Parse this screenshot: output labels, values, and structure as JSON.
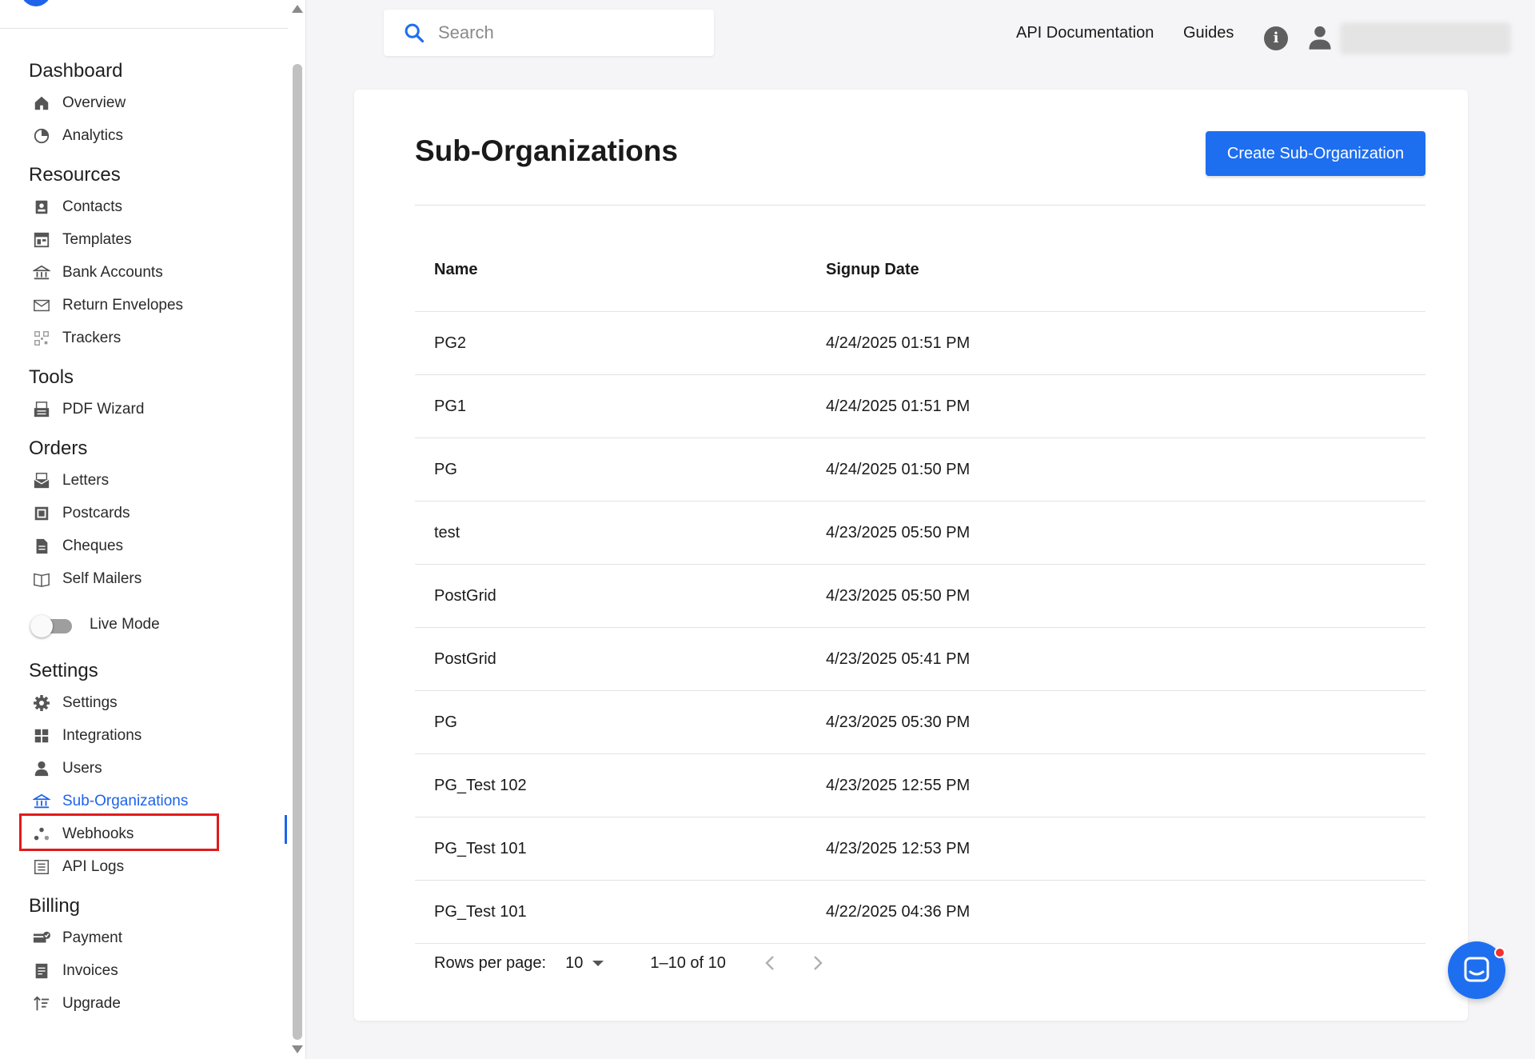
{
  "search": {
    "placeholder": "Search"
  },
  "topnav": {
    "api_docs": "API Documentation",
    "guides": "Guides"
  },
  "sidebar": {
    "sections": [
      {
        "title": "Dashboard",
        "items": [
          {
            "label": "Overview",
            "icon": "home-icon"
          },
          {
            "label": "Analytics",
            "icon": "pie-chart-icon"
          }
        ]
      },
      {
        "title": "Resources",
        "items": [
          {
            "label": "Contacts",
            "icon": "contacts-icon"
          },
          {
            "label": "Templates",
            "icon": "templates-icon"
          },
          {
            "label": "Bank Accounts",
            "icon": "bank-icon"
          },
          {
            "label": "Return Envelopes",
            "icon": "envelope-icon"
          },
          {
            "label": "Trackers",
            "icon": "qr-tracker-icon"
          }
        ]
      },
      {
        "title": "Tools",
        "items": [
          {
            "label": "PDF Wizard",
            "icon": "pdf-wizard-icon"
          }
        ]
      },
      {
        "title": "Orders",
        "items": [
          {
            "label": "Letters",
            "icon": "letter-icon"
          },
          {
            "label": "Postcards",
            "icon": "postcard-icon"
          },
          {
            "label": "Cheques",
            "icon": "cheque-icon"
          },
          {
            "label": "Self Mailers",
            "icon": "self-mailer-icon"
          }
        ]
      }
    ],
    "live_mode_label": "Live Mode",
    "live_mode_on": false,
    "sections2": [
      {
        "title": "Settings",
        "items": [
          {
            "label": "Settings",
            "icon": "gear-icon"
          },
          {
            "label": "Integrations",
            "icon": "integrations-icon"
          },
          {
            "label": "Users",
            "icon": "user-icon"
          },
          {
            "label": "Sub-Organizations",
            "icon": "bank-icon",
            "active": true
          },
          {
            "label": "Webhooks",
            "icon": "webhooks-icon"
          },
          {
            "label": "API Logs",
            "icon": "api-logs-icon"
          }
        ]
      },
      {
        "title": "Billing",
        "items": [
          {
            "label": "Payment",
            "icon": "payment-icon"
          },
          {
            "label": "Invoices",
            "icon": "invoice-icon"
          },
          {
            "label": "Upgrade",
            "icon": "upgrade-icon"
          }
        ]
      }
    ]
  },
  "main": {
    "title": "Sub-Organizations",
    "create_button": "Create Sub-Organization",
    "columns": [
      "Name",
      "Signup Date"
    ],
    "rows": [
      [
        "PG2",
        "4/24/2025 01:51 PM"
      ],
      [
        "PG1",
        "4/24/2025 01:51 PM"
      ],
      [
        "PG",
        "4/24/2025 01:50 PM"
      ],
      [
        "test",
        "4/23/2025 05:50 PM"
      ],
      [
        "PostGrid",
        "4/23/2025 05:50 PM"
      ],
      [
        "PostGrid",
        "4/23/2025 05:41 PM"
      ],
      [
        "PG",
        "4/23/2025 05:30 PM"
      ],
      [
        "PG_Test 102",
        "4/23/2025 12:55 PM"
      ],
      [
        "PG_Test 101",
        "4/23/2025 12:53 PM"
      ],
      [
        "PG_Test 101",
        "4/22/2025 04:36 PM"
      ]
    ],
    "pagination": {
      "rows_per_page_label": "Rows per page:",
      "rows_per_page": "10",
      "range": "1–10 of 10"
    }
  },
  "colors": {
    "accent": "#1e6ef0",
    "highlight_box": "#e01b1b"
  }
}
